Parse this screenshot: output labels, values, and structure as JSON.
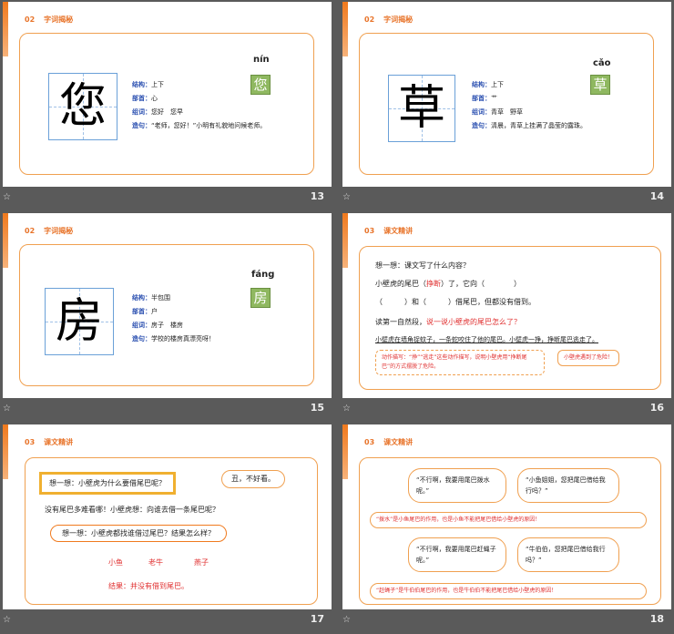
{
  "slides": [
    {
      "num": "13",
      "sec_no": "02",
      "sec_title": "字词揭秘",
      "char": "您",
      "pinyin": "nín",
      "struct_l": "结构：",
      "struct": "上下",
      "rad_l": "部首：",
      "rad": "心",
      "words_l": "组词：",
      "words": "您好　您早",
      "sent_l": "造句：",
      "sent": "“老师，您好！”小明有礼貌地问候老师。"
    },
    {
      "num": "14",
      "sec_no": "02",
      "sec_title": "字词揭秘",
      "char": "草",
      "pinyin": "cǎo",
      "struct_l": "结构：",
      "struct": "上下",
      "rad_l": "部首：",
      "rad": "艹",
      "words_l": "组词：",
      "words": "青草　野草",
      "sent_l": "造句：",
      "sent": "清晨，青草上挂满了晶莹的露珠。"
    },
    {
      "num": "15",
      "sec_no": "02",
      "sec_title": "字词揭秘",
      "char": "房",
      "pinyin": "fáng",
      "struct_l": "结构：",
      "struct": "半包围",
      "rad_l": "部首：",
      "rad": "户",
      "words_l": "组词：",
      "words": "房子　楼房",
      "sent_l": "造句：",
      "sent": "学校的楼房真漂亮呀！"
    },
    {
      "num": "16",
      "sec_no": "03",
      "sec_title": "课文精讲",
      "q1": "想一想：课文写了什么内容？",
      "l1a": "小壁虎的尾巴（",
      "l1b": "挣断",
      "l1c": "）了，它向（　　　　）",
      "l2": "（　　　）和（　　　）借尾巴，但都没有借到。",
      "q2a": "读第一自然段，",
      "q2b": "说一说小壁虎的尾巴怎么了？",
      "p1": "小壁虎在墙角捉蚊子，一条蛇咬住了他的尾巴。小壁虎一挣，挣断尾巴逃走了。",
      "note1": "动作描写：“挣”“逃走”这些动作描写，说明小壁虎用“挣断尾巴”的方式摆脱了危险。",
      "note2": "小壁虎遇到了危险！"
    },
    {
      "num": "17",
      "sec_no": "03",
      "sec_title": "课文精讲",
      "q1": "想一想：小壁虎为什么要借尾巴呢？",
      "bub": "丑，不好看。",
      "l1": "没有尾巴多难看哪！小壁虎想：向谁去借一条尾巴呢？",
      "q2": "想一想：小壁虎都找谁借过尾巴？结果怎么样？",
      "a1": "小鱼",
      "a2": "老牛",
      "a3": "燕子",
      "res": "结果：并没有借到尾巴。"
    },
    {
      "num": "18",
      "sec_no": "03",
      "sec_title": "课文精讲",
      "b1": "“不行啊，我要用尾巴拨水呢。”",
      "b2": "“小鱼姐姐，您把尾巴借给我行吗？”",
      "n1": "“拨水”是小鱼尾巴的作用，也是小鱼不能把尾巴借给小壁虎的原因！",
      "b3": "“不行啊，我要用尾巴赶蝇子呢。”",
      "b4": "“牛伯伯，您把尾巴借给我行吗？”",
      "n2": "“赶蝇子”是牛伯伯尾巴的作用，也是牛伯伯不能把尾巴借给小壁虎的原因！"
    }
  ],
  "colors": {
    "accent": "#f07a1e",
    "label": "#2a4fb0",
    "red": "#e03030"
  },
  "icons": {
    "footer": "star-icon"
  }
}
